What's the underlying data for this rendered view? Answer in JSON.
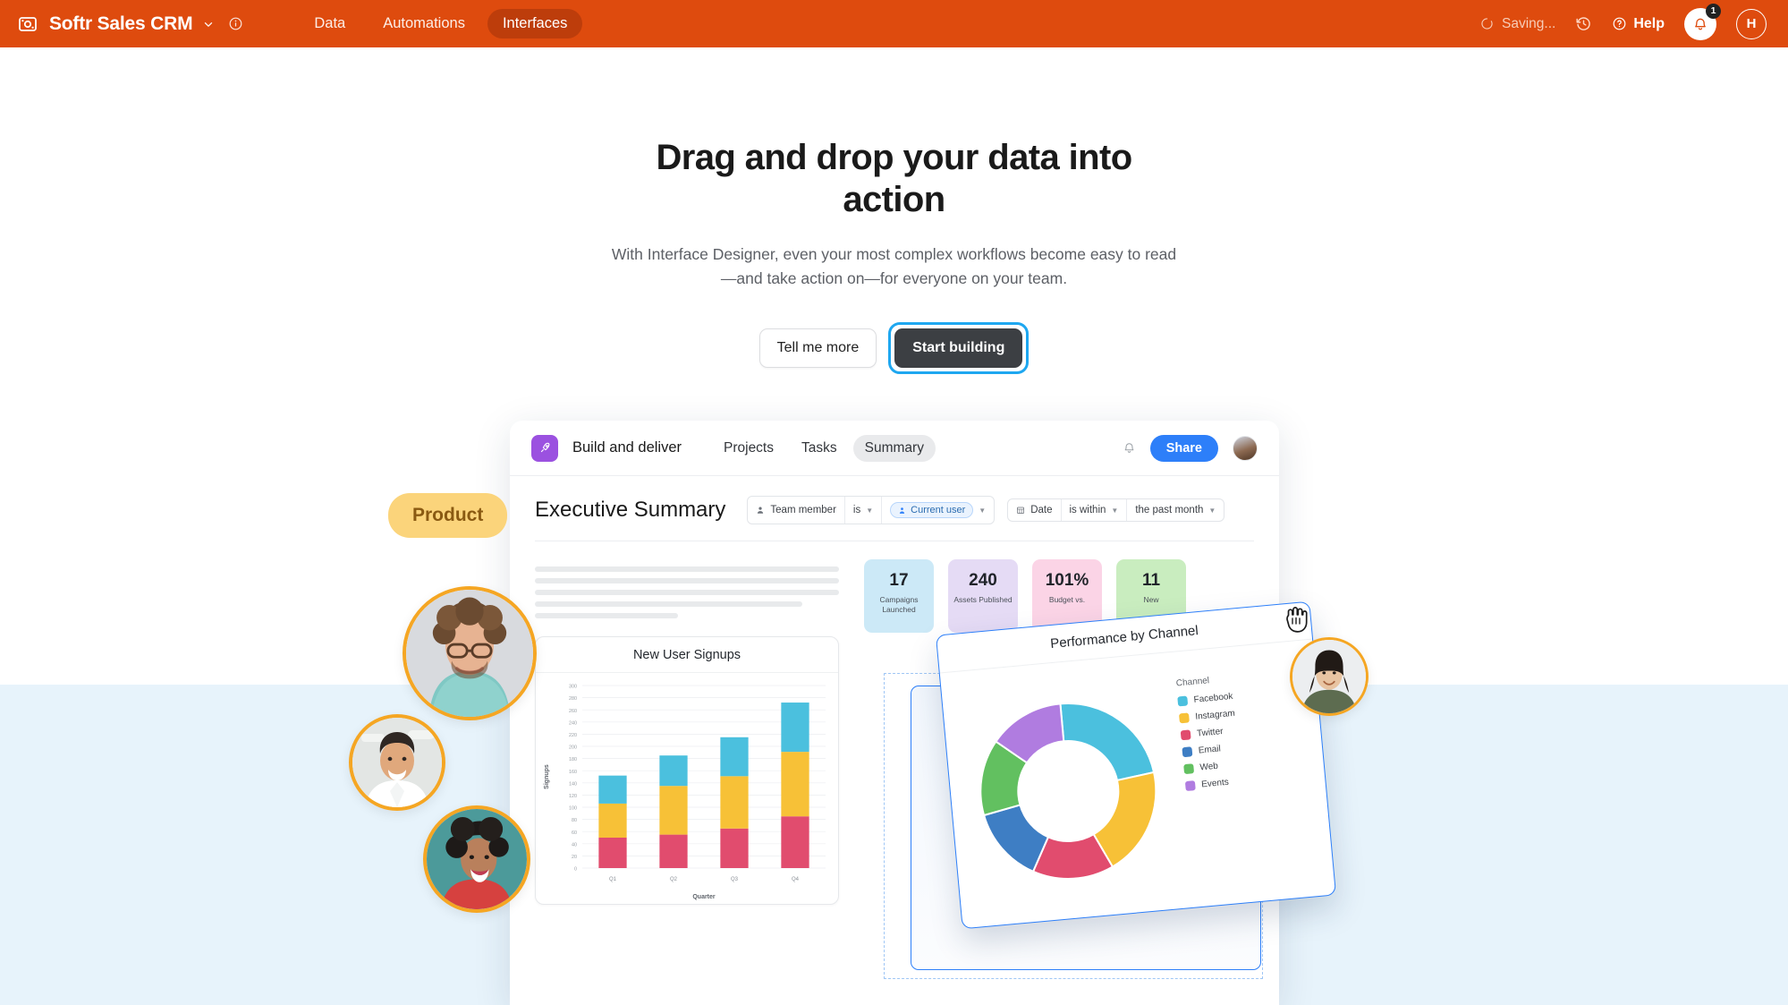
{
  "appbar": {
    "logo_icon": "softr-logo-icon",
    "workspace_title": "Softr Sales CRM",
    "chevron_icon": "chevron-down-icon",
    "info_icon": "info-circle-icon",
    "nav": [
      {
        "label": "Data",
        "active": false
      },
      {
        "label": "Automations",
        "active": false
      },
      {
        "label": "Interfaces",
        "active": true
      }
    ],
    "saving_status": "Saving...",
    "saving_icon": "spinner-icon",
    "history_icon": "history-clock-icon",
    "help_label": "Help",
    "help_icon": "question-circle-icon",
    "notifications_icon": "bell-icon",
    "notifications_count": "1",
    "user_avatar_initial": "H",
    "bg_color": "#DE4B0E",
    "active_pill_color": "#BD3D0B"
  },
  "hero": {
    "title": "Drag and drop your data into action",
    "subtitle": "With Interface Designer, even your most complex workflows become easy to read—and take action on—for everyone on your team.",
    "secondary_button": "Tell me more",
    "primary_button": "Start building",
    "focus_ring_color": "#1EA7F0"
  },
  "illustration": {
    "topbar": {
      "app_icon": "rocket-icon",
      "app_name": "Build and deliver",
      "tabs": [
        {
          "label": "Projects",
          "active": false
        },
        {
          "label": "Tasks",
          "active": false
        },
        {
          "label": "Summary",
          "active": true
        }
      ],
      "bell_icon": "bell-icon",
      "share_button": "Share",
      "avatar": "user-avatar"
    },
    "page_title": "Executive Summary",
    "filters": [
      {
        "field_icon": "person-icon",
        "field": "Team member",
        "operator": "is",
        "value": "Current user",
        "value_icon": "person-badge-icon"
      },
      {
        "field_icon": "calendar-icon",
        "field": "Date",
        "operator": "is within",
        "value": "the past month"
      }
    ],
    "skeleton_widths": [
      "100%",
      "100%",
      "100%",
      "88%",
      "47%"
    ],
    "kpis": [
      {
        "value": "17",
        "label": "Campaigns Launched",
        "color": "#CCE9F7"
      },
      {
        "value": "240",
        "label": "Assets Published",
        "color": "#E5DBF5"
      },
      {
        "value": "101%",
        "label": "Budget vs.",
        "color": "#FBD4E6"
      },
      {
        "value": "11",
        "label": "New",
        "color": "#C9EDBF"
      }
    ],
    "product_badge": "Product",
    "drag_cursor_icon": "grabbing-hand-icon"
  },
  "chart_data": [
    {
      "type": "bar",
      "title": "New User Signups",
      "xlabel": "Quarter",
      "ylabel": "Signups",
      "ylim": [
        0,
        300
      ],
      "yticks": [
        0,
        20,
        40,
        60,
        80,
        100,
        120,
        140,
        160,
        180,
        200,
        220,
        240,
        260,
        280,
        300
      ],
      "categories": [
        "Q1",
        "Q2",
        "Q3",
        "Q4"
      ],
      "stacked": true,
      "series": [
        {
          "name": "Twitter",
          "color": "#E14C6E",
          "values": [
            50,
            55,
            65,
            85
          ]
        },
        {
          "name": "Instagram",
          "color": "#F7C137",
          "values": [
            56,
            80,
            86,
            106
          ]
        },
        {
          "name": "Facebook",
          "color": "#4BC0DE",
          "values": [
            46,
            50,
            64,
            81
          ]
        }
      ],
      "grid": true,
      "legend": "none"
    },
    {
      "type": "pie",
      "title": "Performance by Channel",
      "legend_title": "Channel",
      "legend_position": "right",
      "donut": true,
      "labels": [
        "Facebook",
        "Instagram",
        "Twitter",
        "Email",
        "Web",
        "Events"
      ],
      "values": [
        23,
        20,
        15,
        14,
        14,
        14
      ],
      "colors": [
        "#4BC0DE",
        "#F7C137",
        "#E14C6E",
        "#3E7EC4",
        "#62C060",
        "#B07CE0"
      ]
    }
  ]
}
